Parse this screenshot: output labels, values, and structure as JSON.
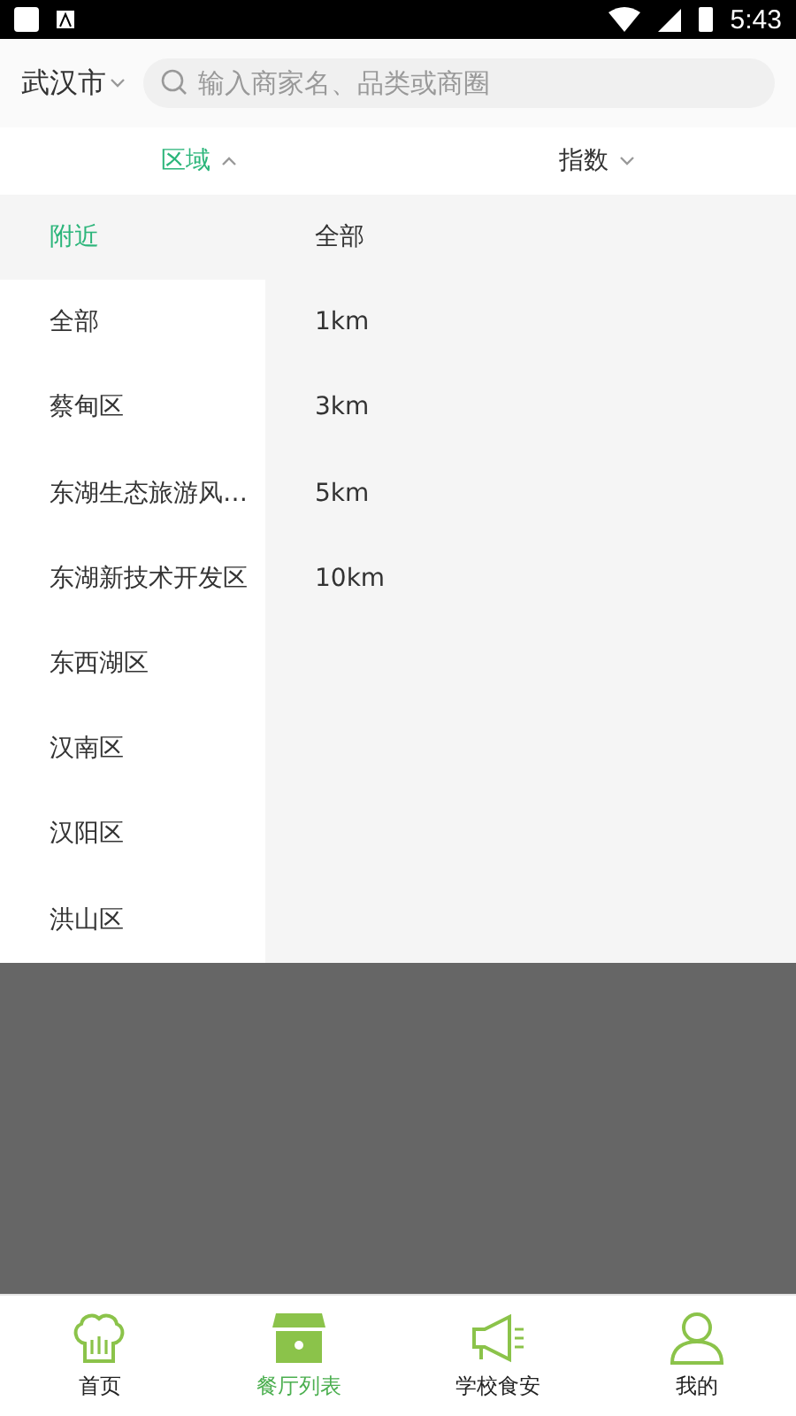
{
  "status_bar": {
    "time": "5:43"
  },
  "header": {
    "city": "武汉市",
    "search": {
      "placeholder": "输入商家名、品类或商圈"
    }
  },
  "filters": [
    {
      "label": "区域",
      "selected": true,
      "expanded": true
    },
    {
      "label": "指数",
      "selected": false,
      "expanded": false
    }
  ],
  "districts": [
    {
      "label": "附近",
      "selected": true
    },
    {
      "label": "全部",
      "selected": false
    },
    {
      "label": "蔡甸区",
      "selected": false
    },
    {
      "label": "东湖生态旅游风…",
      "selected": false
    },
    {
      "label": "东湖新技术开发区",
      "selected": false
    },
    {
      "label": "东西湖区",
      "selected": false
    },
    {
      "label": "汉南区",
      "selected": false
    },
    {
      "label": "汉阳区",
      "selected": false
    },
    {
      "label": "洪山区",
      "selected": false
    }
  ],
  "distances": [
    {
      "label": "全部",
      "selected": false
    },
    {
      "label": "1km",
      "selected": false
    },
    {
      "label": "3km",
      "selected": false
    },
    {
      "label": "5km",
      "selected": false
    },
    {
      "label": "10km",
      "selected": false
    }
  ],
  "tab_bar": [
    {
      "kind": "home",
      "label": "首页",
      "selected": false
    },
    {
      "kind": "store",
      "label": "餐厅列表",
      "selected": true
    },
    {
      "kind": "megaphone",
      "label": "学校食安",
      "selected": false
    },
    {
      "kind": "person",
      "label": "我的",
      "selected": false
    }
  ]
}
